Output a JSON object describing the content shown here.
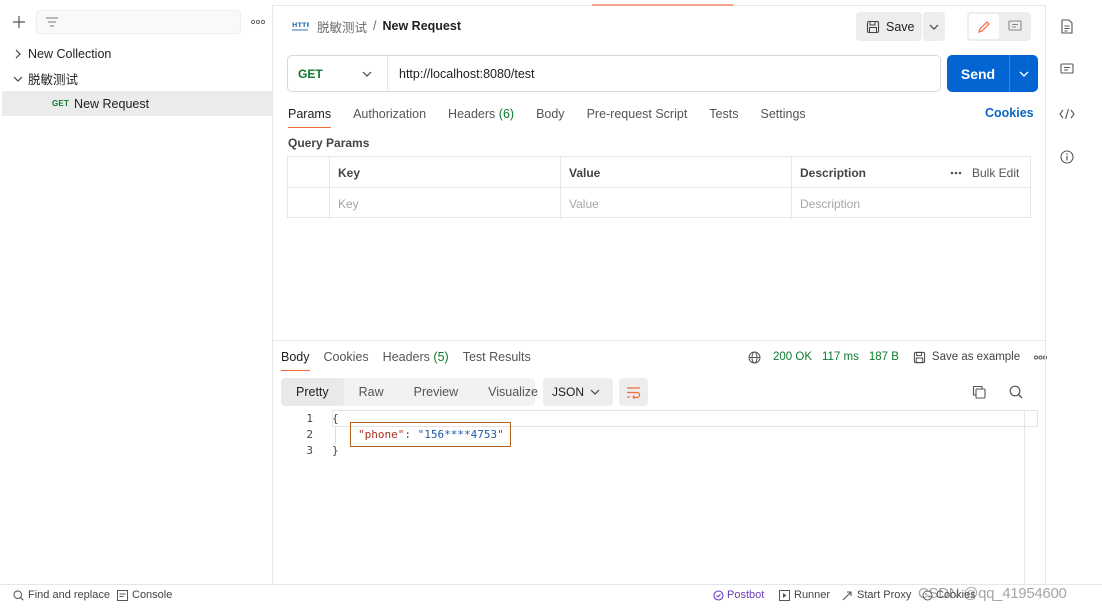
{
  "sidebar": {
    "collections": [
      {
        "name": "New Collection",
        "expanded": false
      },
      {
        "name": "脱敏测试",
        "expanded": true
      }
    ],
    "request": {
      "method": "GET",
      "name": "New Request"
    }
  },
  "header": {
    "breadcrumb_parent": "脱敏测试",
    "breadcrumb_sep": "/",
    "title": "New Request",
    "save_label": "Save"
  },
  "request": {
    "method": "GET",
    "url": "http://localhost:8080/test",
    "send_label": "Send",
    "tabs": [
      {
        "label": "Params",
        "active": true
      },
      {
        "label": "Authorization"
      },
      {
        "label": "Headers",
        "count": "(6)"
      },
      {
        "label": "Body"
      },
      {
        "label": "Pre-request Script"
      },
      {
        "label": "Tests"
      },
      {
        "label": "Settings"
      }
    ],
    "cookies_label": "Cookies",
    "query_params_title": "Query Params",
    "params_table": {
      "headers": {
        "key": "Key",
        "value": "Value",
        "description": "Description",
        "bulk_edit": "Bulk Edit"
      },
      "placeholders": {
        "key": "Key",
        "value": "Value",
        "description": "Description"
      }
    }
  },
  "response": {
    "tabs": [
      {
        "label": "Body",
        "active": true
      },
      {
        "label": "Cookies"
      },
      {
        "label": "Headers",
        "count": "(5)"
      },
      {
        "label": "Test Results"
      }
    ],
    "status": "200 OK",
    "time": "117 ms",
    "size": "187 B",
    "save_example": "Save as example",
    "view_tabs": [
      "Pretty",
      "Raw",
      "Preview",
      "Visualize"
    ],
    "format": "JSON",
    "code_lines": [
      {
        "num": "1",
        "text": "{"
      },
      {
        "num": "2",
        "key": "\"phone\"",
        "colon": ": ",
        "value": "\"156****4753\""
      },
      {
        "num": "3",
        "text": "}"
      }
    ]
  },
  "footer": {
    "find_replace": "Find and replace",
    "console": "Console",
    "postbot": "Postbot",
    "runner": "Runner",
    "start_proxy": "Start Proxy",
    "cookies": "Cookies",
    "watermark": "CSDN @qq_41954600"
  },
  "colors": {
    "accent_orange": "#f26b3a",
    "send_blue": "#0265d2",
    "get_green": "#0b7c2c",
    "status_green": "#0b7c2c",
    "link_blue": "#0a66c2",
    "highlight_border": "#b5651d",
    "postbot_purple": "#6b3fb8"
  }
}
